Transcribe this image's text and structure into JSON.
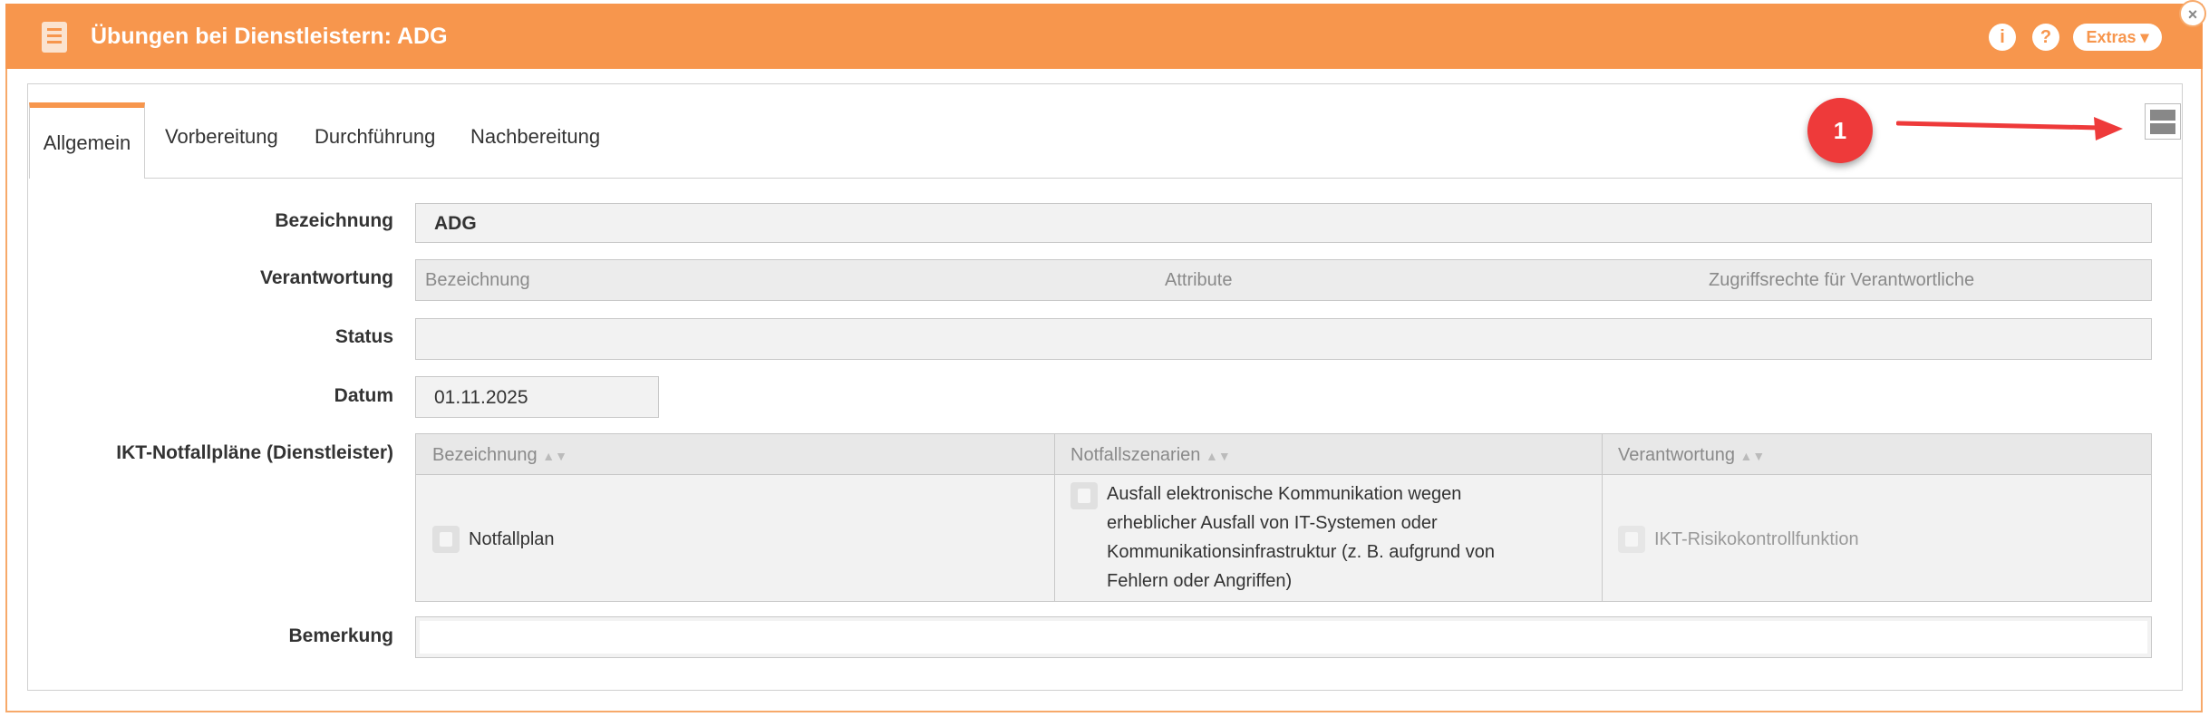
{
  "window": {
    "title": "Übungen bei Dienstleistern: ADG",
    "info_label": "i",
    "help_label": "?",
    "extras_label": "Extras ▾",
    "close_label": "×"
  },
  "tabs": [
    {
      "label": "Allgemein"
    },
    {
      "label": "Vorbereitung"
    },
    {
      "label": "Durchführung"
    },
    {
      "label": "Nachbereitung"
    }
  ],
  "annotation": {
    "badge": "1"
  },
  "form": {
    "bezeichnung_label": "Bezeichnung",
    "bezeichnung_value": "ADG",
    "verantwortung_label": "Verantwortung",
    "verantwortung_columns": [
      "Bezeichnung",
      "Attribute",
      "Zugriffsrechte für Verantwortliche"
    ],
    "status_label": "Status",
    "status_value": "",
    "datum_label": "Datum",
    "datum_value": "01.11.2025",
    "ikt_label": "IKT-Notfallpläne (Dienstleister)",
    "ikt_columns": [
      "Bezeichnung",
      "Notfallszenarien",
      "Verantwortung"
    ],
    "ikt_row": {
      "bezeichnung": "Notfallplan",
      "szenario_lines": [
        "Ausfall elektronische Kommunikation wegen",
        "erheblicher Ausfall von IT-Systemen oder",
        "Kommunikationsinfrastruktur (z. B. aufgrund von",
        "Fehlern oder Angriffen)"
      ],
      "verantwortung": "IKT-Risikokontrollfunktion"
    },
    "bemerkung_label": "Bemerkung",
    "bemerkung_value": ""
  },
  "colors": {
    "accent": "#f7964d",
    "badge": "#ee3a3a"
  }
}
